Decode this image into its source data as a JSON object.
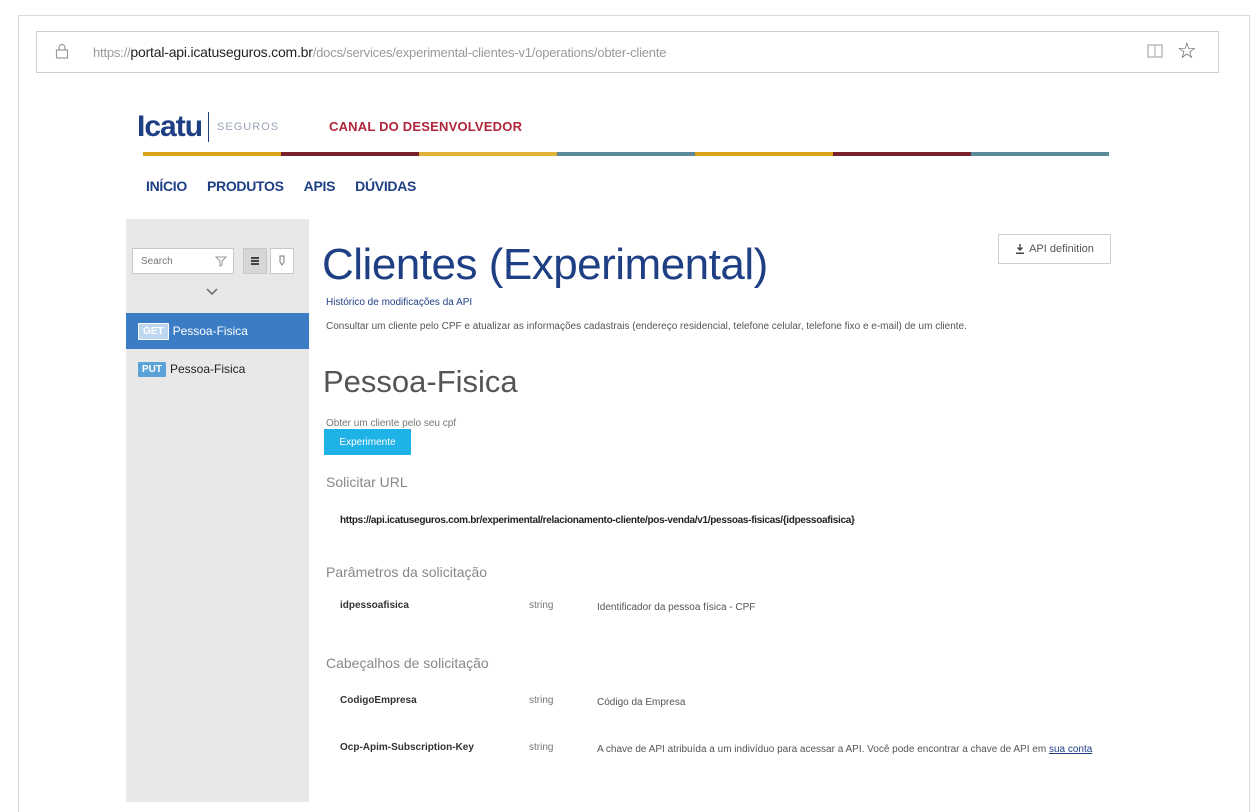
{
  "browser": {
    "url_prefix": "https://",
    "url_domain": "portal-api.icatuseguros.com.br",
    "url_path": "/docs/services/experimental-clientes-v1/operations/obter-cliente"
  },
  "header": {
    "brand": "Icatu",
    "brand_sub": "SEGUROS",
    "canal": "CANAL DO DESENVOLVEDOR",
    "stripe_colors": [
      "#d9a21b",
      "#7a1f2c",
      "#e0b23a",
      "#5d8a9a",
      "#d9a21b",
      "#7a1f2c",
      "#5d8a9a"
    ]
  },
  "nav": {
    "items": [
      {
        "label": "INÍCIO"
      },
      {
        "label": "PRODUTOS"
      },
      {
        "label": "APIS"
      },
      {
        "label": "DÚVIDAS"
      }
    ]
  },
  "sidebar": {
    "search_placeholder": "Search",
    "operations": [
      {
        "method": "GET",
        "label": "Pessoa-Fisica",
        "selected": true
      },
      {
        "method": "PUT",
        "label": "Pessoa-Fisica",
        "selected": false
      }
    ]
  },
  "main": {
    "title": "Clientes (Experimental)",
    "api_definition_label": "API definition",
    "history_link": "Histórico de modificações da API",
    "description": "Consultar um cliente pelo CPF e atualizar as informações cadastrais (endereço residencial, telefone celular, telefone fixo e e-mail) de um cliente.",
    "operation_title": "Pessoa-Fisica",
    "operation_desc": "Obter um cliente pelo seu cpf",
    "try_it_label": "Experimente",
    "request_url_heading": "Solicitar URL",
    "request_url": "https://api.icatuseguros.com.br/experimental/relacionamento-cliente/pos-venda/v1/pessoas-fisicas/{idpessoafisica}",
    "params_heading": "Parâmetros da solicitação",
    "params": [
      {
        "name": "idpessoafisica",
        "type": "string",
        "desc": "Identificador da pessoa física - CPF"
      }
    ],
    "headers_heading": "Cabeçalhos de solicitação",
    "headers": [
      {
        "name": "CodigoEmpresa",
        "type": "string",
        "desc": "Código da Empresa",
        "link": ""
      },
      {
        "name": "Ocp-Apim-Subscription-Key",
        "type": "string",
        "desc": "A chave de API atribuída a um indivíduo para acessar a API. Você pode encontrar a chave de API em ",
        "link": "sua conta"
      }
    ]
  }
}
